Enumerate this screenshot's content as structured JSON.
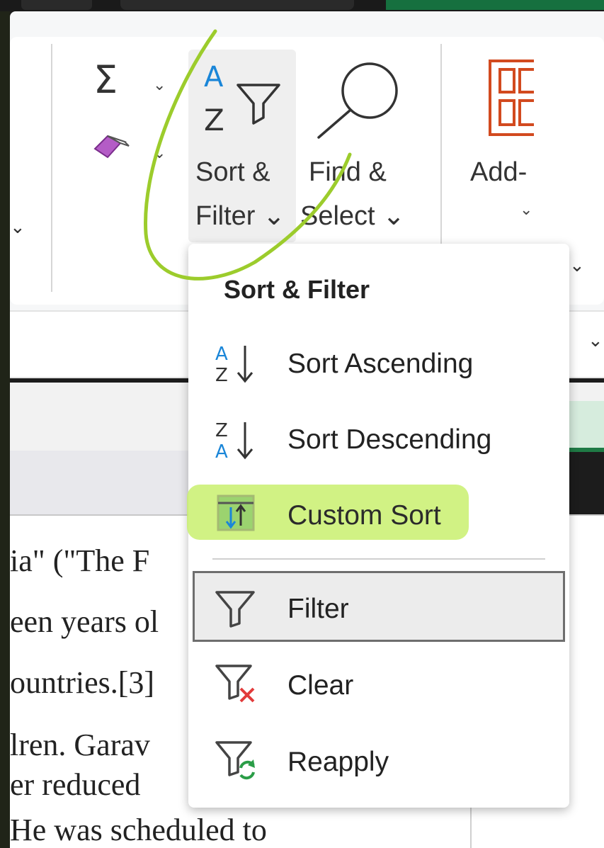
{
  "ribbon": {
    "sort_filter_line1": "Sort &",
    "sort_filter_line2": "Filter ⌄",
    "find_select_line1": "Find &",
    "find_select_line2": "Select ⌄",
    "addins_line1": "Add-",
    "addins_line2": "⌄",
    "autosum_dropdown": "⌄",
    "clear_dropdown": "⌄"
  },
  "menu": {
    "title": "Sort & Filter",
    "items": [
      {
        "label": "Sort Ascending",
        "icon": "sort-ascending-icon"
      },
      {
        "label": "Sort Descending",
        "icon": "sort-descending-icon"
      },
      {
        "label": "Custom Sort",
        "icon": "custom-sort-icon",
        "highlighted": true
      },
      {
        "label": "Filter",
        "icon": "filter-icon",
        "focused": true
      },
      {
        "label": "Clear",
        "icon": "clear-filter-icon"
      },
      {
        "label": "Reapply",
        "icon": "reapply-filter-icon"
      }
    ]
  },
  "document": {
    "lines": [
      "ia\" (\"The F",
      "een years ol",
      "ountries.[3]",
      "lren. Garav",
      "er reduced",
      "He was scheduled to"
    ]
  },
  "colors": {
    "highlight": "#c9f06f",
    "annotation_stroke": "#9ccc2c",
    "excel_green": "#1f7a45",
    "addins_orange": "#d24a1f",
    "sort_blue": "#1a86d8"
  }
}
